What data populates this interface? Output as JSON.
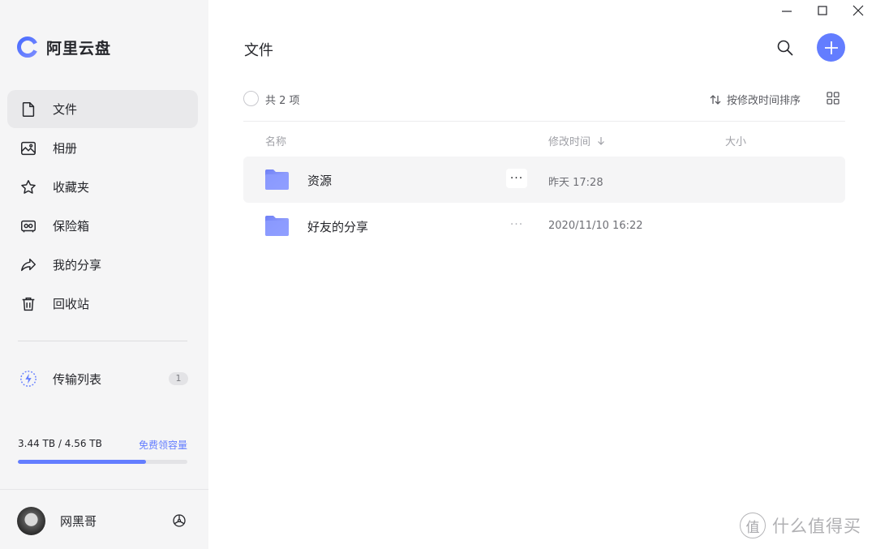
{
  "app": {
    "name": "阿里云盘"
  },
  "sidebar": {
    "items": [
      {
        "label": "文件",
        "icon": "file-icon",
        "active": true
      },
      {
        "label": "相册",
        "icon": "photo-album-icon",
        "active": false
      },
      {
        "label": "收藏夹",
        "icon": "star-icon",
        "active": false
      },
      {
        "label": "保险箱",
        "icon": "safe-box-icon",
        "active": false
      },
      {
        "label": "我的分享",
        "icon": "share-arrow-icon",
        "active": false
      },
      {
        "label": "回收站",
        "icon": "trash-icon",
        "active": false
      }
    ],
    "transfer": {
      "label": "传输列表",
      "icon": "lightning-icon",
      "count": "1"
    },
    "storage": {
      "used_text": "3.44 TB / 4.56 TB",
      "link": "免费领容量",
      "used_fraction": 0.754
    },
    "user": {
      "name": "网黑哥",
      "icon": "settings-icon"
    }
  },
  "main": {
    "title": "文件",
    "count_text": "共 2 项",
    "sort_label": "按修改时间排序",
    "columns": {
      "name": "名称",
      "modified": "修改时间",
      "size": "大小"
    },
    "rows": [
      {
        "name": "资源",
        "modified": "昨天 17:28",
        "size": "",
        "more": "···"
      },
      {
        "name": "好友的分享",
        "modified": "2020/11/10 16:22",
        "size": "",
        "more": "···"
      }
    ]
  },
  "watermark": {
    "logo": "值",
    "text": "什么值得买"
  },
  "colors": {
    "accent": "#637dff",
    "sidebar_bg": "#f5f5f6",
    "folder": "#7d8cf8"
  }
}
